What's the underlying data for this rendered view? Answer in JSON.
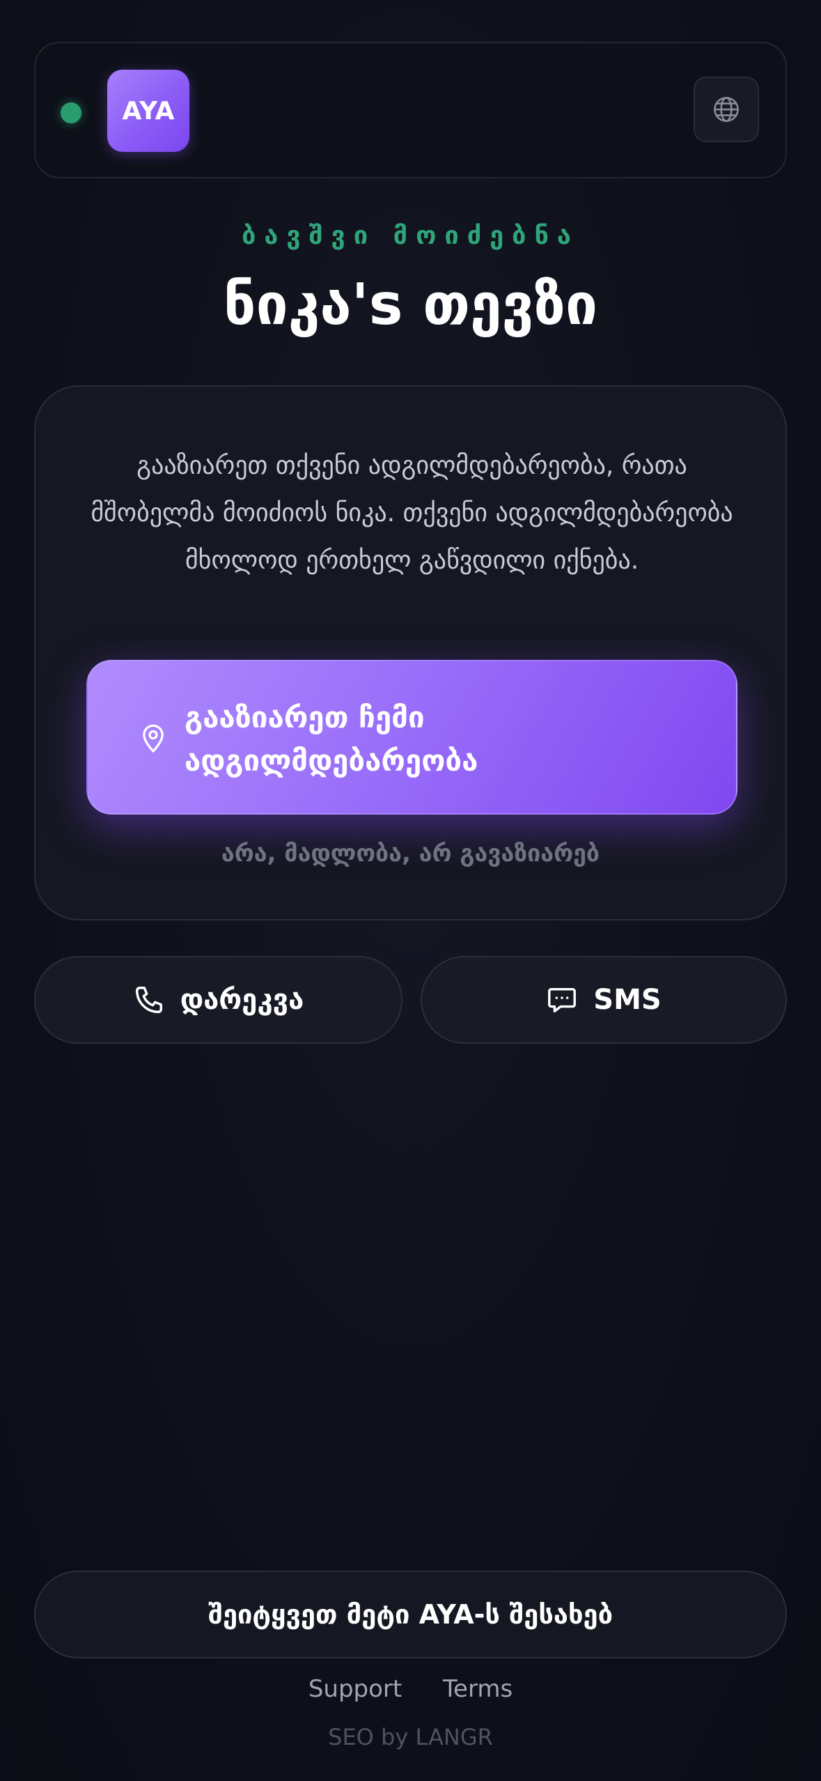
{
  "header": {
    "logo_text": "AYA",
    "status_color": "#2a9d6f",
    "language_icon": "globe-icon"
  },
  "hero": {
    "subtitle": "ბავშვი მოიძებნა",
    "title": "ნიკა's თევზი"
  },
  "card": {
    "description": "გააზიარეთ თქვენი ადგილმდებარეობა, რათა მშობელმა მოიძიოს ნიკა. თქვენი ადგილმდებარეობა მხოლოდ ერთხელ გაწვდილი იქნება.",
    "share_button_label": "გააზიარეთ ჩემი ადგილმდებარეობა",
    "share_icon": "location-pin-icon",
    "decline_label": "არა, მადლობა, არ გავაზიარებ"
  },
  "actions": {
    "call_label": "დარეკვა",
    "call_icon": "phone-icon",
    "sms_label": "SMS",
    "sms_icon": "message-icon"
  },
  "footer": {
    "learn_more_label": "შეიტყვეთ მეტი AYA-ს შესახებ",
    "support_label": "Support",
    "terms_label": "Terms",
    "seo_label": "SEO by LANGR"
  },
  "colors": {
    "accent": "#8b5cf6",
    "accent_light": "#b08cfc",
    "success": "#2fa57a",
    "background": "#0f111b"
  }
}
